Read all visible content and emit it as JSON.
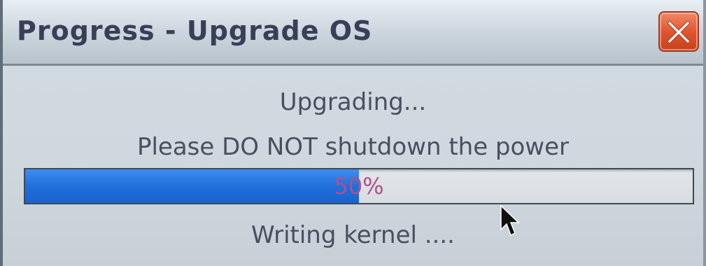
{
  "window": {
    "title": "Progress - Upgrade OS",
    "close_icon": "close-icon"
  },
  "status": {
    "main": "Upgrading...",
    "warning": "Please DO NOT shutdown the power",
    "detail": "Writing kernel ...."
  },
  "progress": {
    "value": 0.5,
    "label": "50%"
  },
  "colors": {
    "progress_fill": "#1f6fdc",
    "progress_text": "#b0508a",
    "close_button": "#e0552f",
    "title_text": "#3a3f58"
  }
}
